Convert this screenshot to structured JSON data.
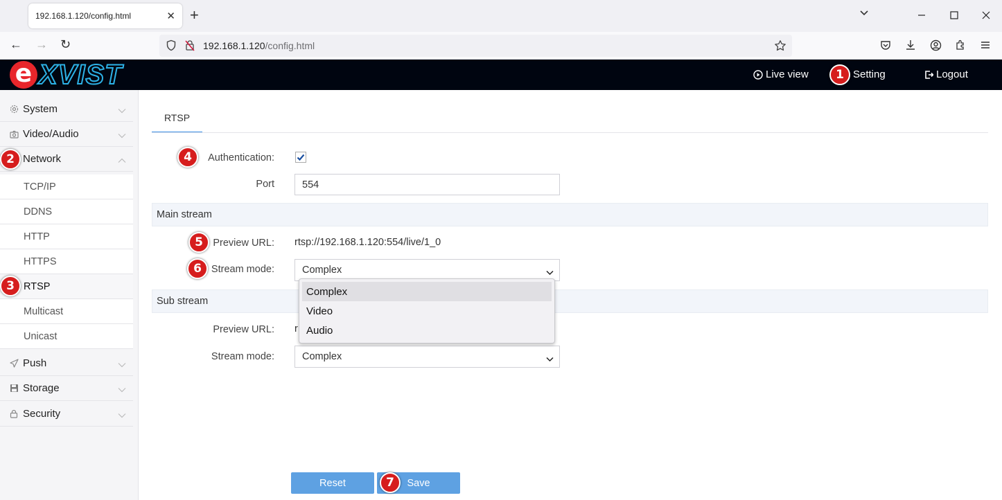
{
  "browser": {
    "tab_title": "192.168.1.120/config.html",
    "tab_close": "✕",
    "new_tab": "+",
    "url_host": "192.168.1.120",
    "url_path": "/config.html",
    "win_list": "⌄",
    "win_min": "—",
    "win_max": "☐",
    "win_close": "✕",
    "back": "←",
    "forward": "→",
    "reload": "↻"
  },
  "header": {
    "logo_e": "e",
    "logo_rest": "XVIST",
    "live_view": "Live view",
    "setting": "Setting",
    "logout": "Logout"
  },
  "sidebar": {
    "system": "System",
    "video_audio": "Video/Audio",
    "network": "Network",
    "network_sub": [
      "TCP/IP",
      "DDNS",
      "HTTP",
      "HTTPS",
      "RTSP",
      "Multicast",
      "Unicast"
    ],
    "push": "Push",
    "storage": "Storage",
    "security": "Security"
  },
  "content": {
    "tab": "RTSP",
    "auth_label": "Authentication:",
    "auth_checked": true,
    "port_label": "Port",
    "port_value": "554",
    "main_stream": "Main stream",
    "main_preview_label": "Preview URL:",
    "main_preview_url": "rtsp://192.168.1.120:554/live/1_0",
    "main_mode_label": "Stream mode:",
    "main_mode_value": "Complex",
    "sub_stream": "Sub stream",
    "sub_preview_label": "Preview URL:",
    "sub_preview_url_visible": "r",
    "sub_mode_label": "Stream mode:",
    "sub_mode_value": "Complex",
    "dropdown_options": [
      "Complex",
      "Video",
      "Audio"
    ],
    "reset": "Reset",
    "save": "Save"
  },
  "markers": [
    "1",
    "2",
    "3",
    "4",
    "5",
    "6",
    "7"
  ],
  "colors": {
    "header_bg": "#000510",
    "accent": "#3a8ee6",
    "button": "#5ea1e2",
    "marker": "#d61d1d"
  }
}
